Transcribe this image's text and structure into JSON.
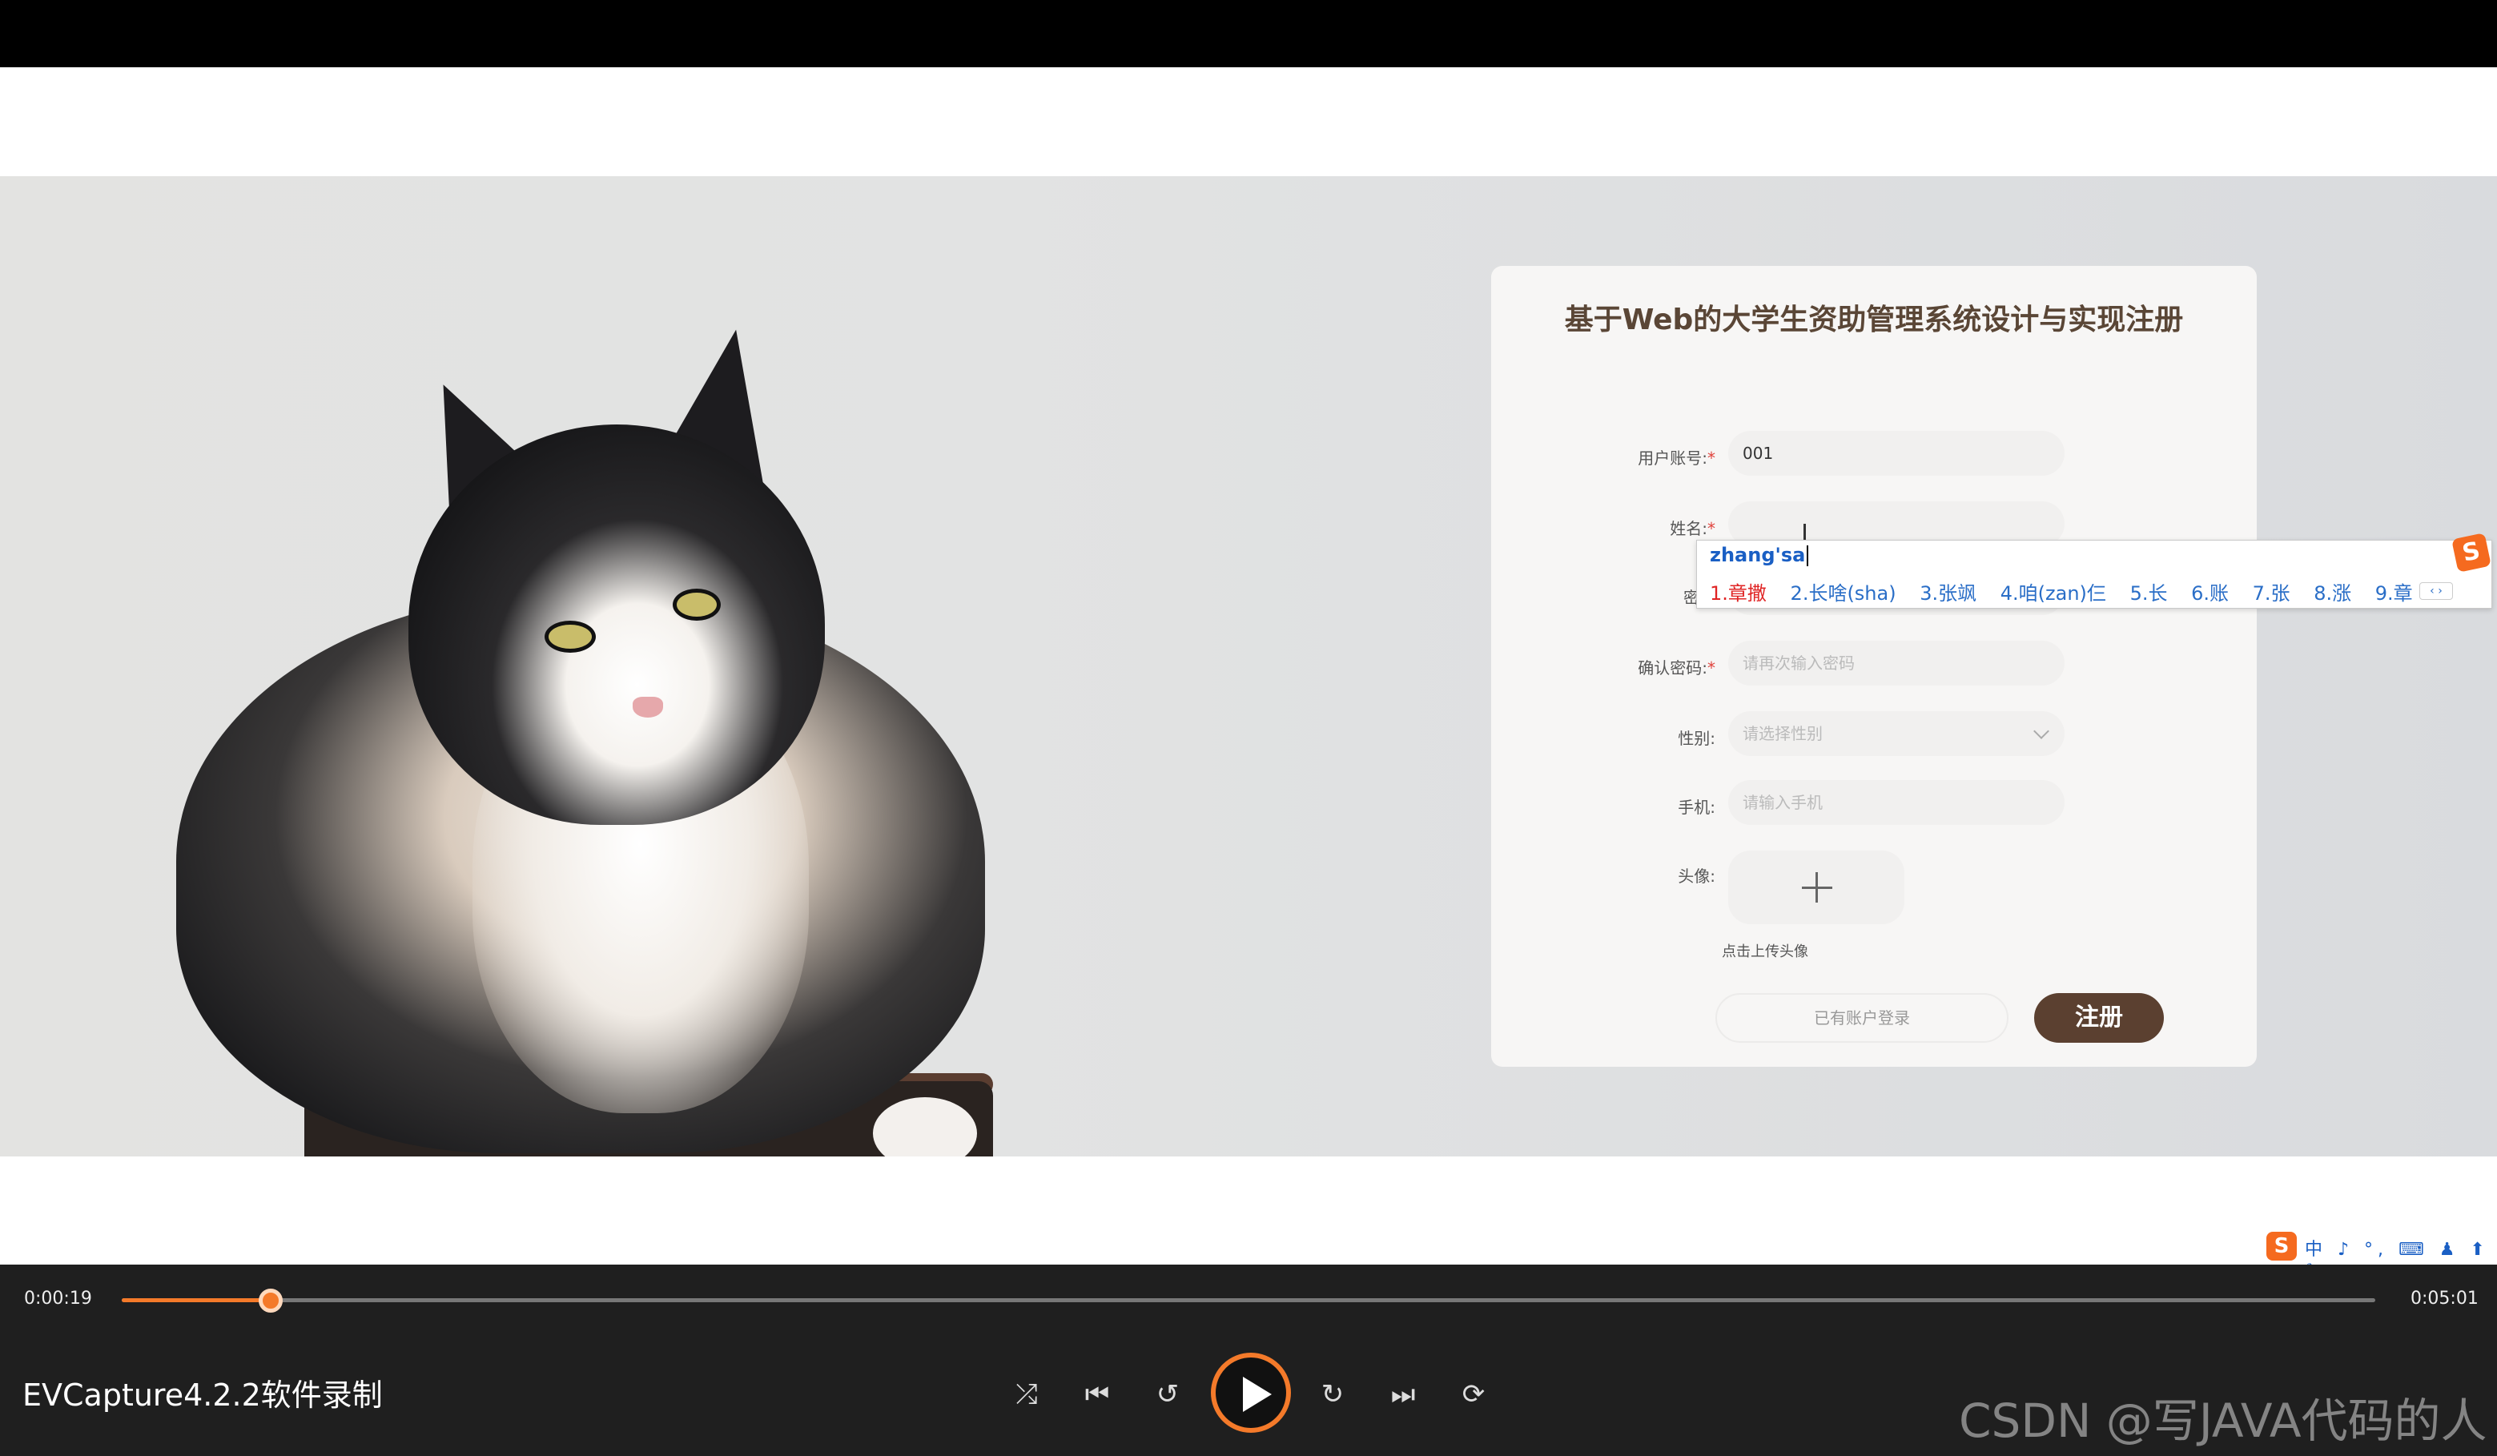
{
  "form": {
    "title": "基于Web的大学生资助管理系统设计与实现注册",
    "account_label": "用户账号:",
    "account_value": "001",
    "name_label": "姓名:",
    "password_label": "密码",
    "confirm_label": "确认密码:",
    "confirm_placeholder": "请再次输入密码",
    "gender_label": "性别:",
    "gender_placeholder": "请选择性别",
    "phone_label": "手机:",
    "phone_placeholder": "请输入手机",
    "avatar_label": "头像:",
    "avatar_hint": "点击上传头像",
    "login_link": "已有账户登录",
    "register_button": "注册",
    "required_mark": "*"
  },
  "ime": {
    "input": "zhang'sa",
    "candidates": [
      "1.章撒",
      "2.长啥(sha)",
      "3.张飒",
      "4.咱(zan)仨",
      "5.长",
      "6.账",
      "7.张",
      "8.涨",
      "9.章"
    ],
    "logo": "S",
    "nav": "‹ ›",
    "tray_text": "中 ♪ °, ⌨ ♟ ⬆ ✎"
  },
  "player": {
    "current_time": "0:00:19",
    "total_time": "0:05:01",
    "progress": 0.066,
    "app_label": "EVCapture4.2.2软件录制",
    "watermark": "CSDN @写JAVA代码的人"
  },
  "colors": {
    "accent": "#f47a2a",
    "brand": "#5b4030",
    "ime_blue": "#1a5fc4"
  }
}
